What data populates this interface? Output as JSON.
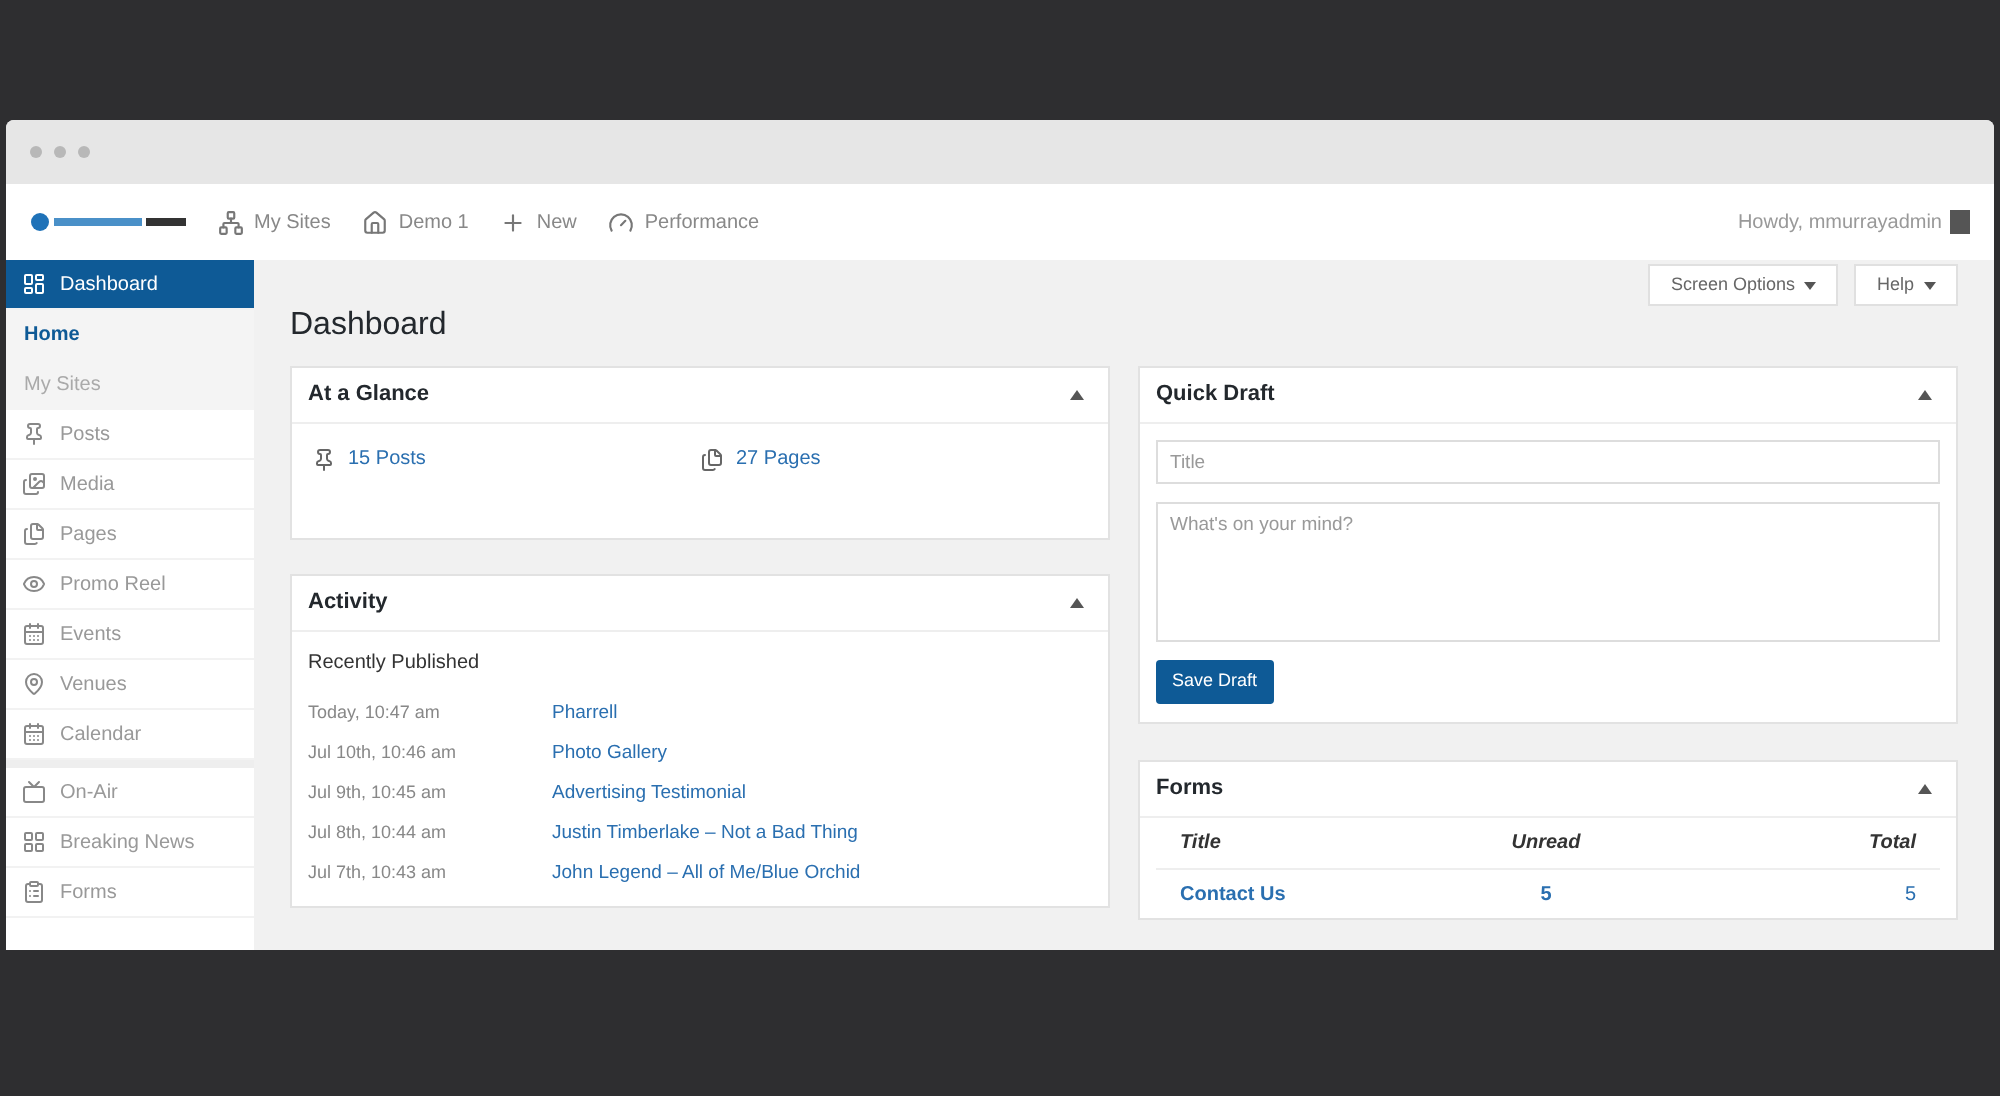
{
  "admin_bar": {
    "items": [
      {
        "kind": "sites",
        "label": "My Sites"
      },
      {
        "kind": "home",
        "label": "Demo 1"
      },
      {
        "kind": "new",
        "label": "New"
      },
      {
        "kind": "performance",
        "label": "Performance"
      }
    ],
    "greeting": "Howdy, mmurrayadmin"
  },
  "sidebar": {
    "items": [
      {
        "kind": "dashboard",
        "label": "Dashboard",
        "selected": true,
        "children": [
          {
            "label": "Home",
            "selected": true
          },
          {
            "label": "My Sites",
            "selected": false
          }
        ]
      },
      {
        "kind": "pin",
        "label": "Posts",
        "selected": false
      },
      {
        "kind": "media",
        "label": "Media",
        "selected": false
      },
      {
        "kind": "pages",
        "label": "Pages",
        "selected": false
      },
      {
        "kind": "eye",
        "label": "Promo Reel",
        "selected": false
      },
      {
        "kind": "calendar",
        "label": "Events",
        "selected": false
      },
      {
        "kind": "location",
        "label": "Venues",
        "selected": false
      },
      {
        "kind": "calendar",
        "label": "Calendar",
        "selected": false
      },
      {
        "kind": "separator"
      },
      {
        "kind": "onair",
        "label": "On-Air",
        "selected": false
      },
      {
        "kind": "grid",
        "label": "Breaking News",
        "selected": false
      },
      {
        "kind": "forms",
        "label": "Forms",
        "selected": false
      }
    ]
  },
  "page": {
    "title": "Dashboard",
    "buttons": [
      "Screen Options",
      "Help"
    ]
  },
  "at_a_glance": {
    "title": "At a Glance",
    "expanded": true,
    "items": [
      {
        "kind": "pin",
        "label": "15 Posts"
      },
      {
        "kind": "pages",
        "label": "27 Pages"
      }
    ]
  },
  "activity": {
    "title": "Activity",
    "expanded": true,
    "subtitle": "Recently Published",
    "rows": [
      {
        "date": "Today, 10:47 am",
        "title": "Pharrell"
      },
      {
        "date": "Jul 10th, 10:46 am",
        "title": "Photo Gallery"
      },
      {
        "date": "Jul 9th, 10:45 am",
        "title": "Advertising Testimonial"
      },
      {
        "date": "Jul 8th, 10:44 am",
        "title": "Justin Timberlake – Not a Bad Thing"
      },
      {
        "date": "Jul 7th, 10:43 am",
        "title": "John Legend – All of Me/Blue Orchid"
      }
    ]
  },
  "quick_draft": {
    "title": "Quick Draft",
    "expanded": true,
    "title_placeholder": "Title",
    "content_placeholder": "What's on your mind?",
    "button": "Save Draft"
  },
  "forms": {
    "title": "Forms",
    "expanded": true,
    "columns": [
      "Title",
      "Unread",
      "Total"
    ],
    "rows": [
      {
        "title": "Contact Us",
        "unread": "5",
        "total": "5"
      }
    ]
  }
}
